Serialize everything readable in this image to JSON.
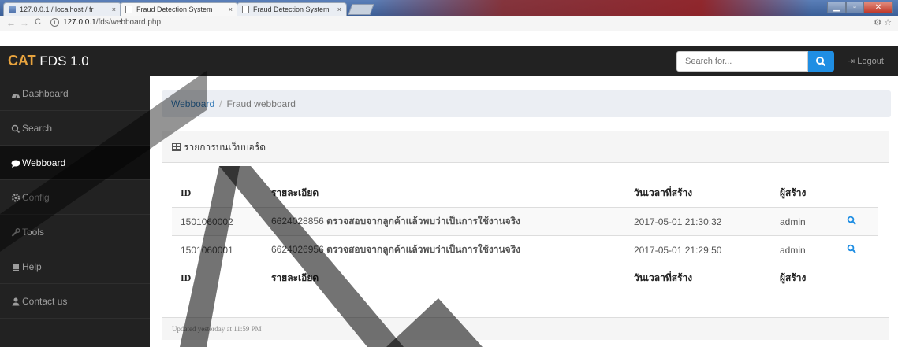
{
  "browser": {
    "tabs": [
      {
        "label": "127.0.0.1 / localhost / fr",
        "close": "×"
      },
      {
        "label": "Fraud Detection System",
        "close": "×"
      },
      {
        "label": "Fraud Detection System",
        "close": "×"
      }
    ],
    "url_host": "127.0.0.1",
    "url_path": "/fds/webboard.php",
    "back": "←",
    "forward": "→",
    "reload": "C",
    "info": "i",
    "right_icons": "⚙ ☆"
  },
  "navbar": {
    "logo": "CAT",
    "product": "FDS 1.0",
    "search_placeholder": "Search for...",
    "logout_label": "Logout",
    "logout_icon": "⇥"
  },
  "sidebar": {
    "items": [
      {
        "label": "Dashboard",
        "icon": "dashboard-icon"
      },
      {
        "label": "Search",
        "icon": "search-icon"
      },
      {
        "label": "Webboard",
        "icon": "comment-icon"
      },
      {
        "label": "Config",
        "icon": "cog-icon"
      },
      {
        "label": "Tools",
        "icon": "wrench-icon"
      },
      {
        "label": "Help",
        "icon": "book-icon"
      },
      {
        "label": "Contact us",
        "icon": "user-icon"
      }
    ],
    "active": "Webboard"
  },
  "breadcrumb": {
    "link": "Webboard",
    "separator": "/",
    "current": "Fraud webboard"
  },
  "card": {
    "title": "รายการบนเว็บบอร์ด",
    "footer": "Updated yesterday at 11:59 PM"
  },
  "table": {
    "headers": [
      "ID",
      "รายละเอียด",
      "วันเวลาที่สร้าง",
      "ผู้สร้าง"
    ],
    "rows": [
      {
        "id": "1501060002",
        "detail_num": "6624028856",
        "detail_text": "ตรวจสอบจากลูกค้าแล้วพบว่าเป็นการใช้งานจริง",
        "created": "2017-05-01 21:30:32",
        "creator": "admin"
      },
      {
        "id": "1501060001",
        "detail_num": "6624026956",
        "detail_text": "ตรวจสอบจากลูกค้าแล้วพบว่าเป็นการใช้งานจริง",
        "created": "2017-05-01 21:29:50",
        "creator": "admin"
      }
    ],
    "footer_headers": [
      "ID",
      "รายละเอียด",
      "วันเวลาที่สร้าง",
      "ผู้สร้าง"
    ]
  },
  "colors": {
    "navbar_bg": "#222222",
    "logo_accent": "#e7a33e",
    "search_button": "#1f8ee3",
    "link": "#337ab7"
  }
}
